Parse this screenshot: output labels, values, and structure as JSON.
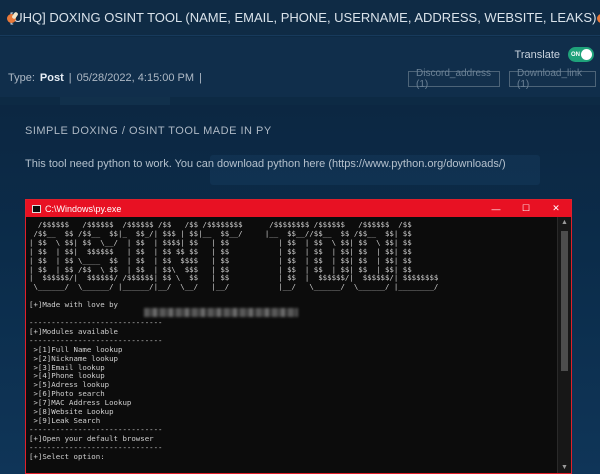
{
  "post": {
    "title": "[UHQ] DOXING OSINT TOOL (NAME, EMAIL, PHONE, USERNAME, ADDRESS, WEBSITE, LEAKS)",
    "title_icon_left": "meat-icon",
    "title_icon_right": "meat-icon",
    "translate_label": "Translate",
    "translate_toggle": "ON",
    "type_label": "Type:",
    "type_value": "Post",
    "separator": "|",
    "date": "05/28/2022, 4:15:00 PM",
    "discord_link": "Discord_address (1)",
    "download_link": "Download_link (1)"
  },
  "body": {
    "heading": "SIMPLE  DOXING  /  OSINT TOOL  MADE IN  PY",
    "intro": "This tool need python to work. You can download python here (https://www.python.org/downloads/)"
  },
  "window": {
    "title": "C:\\Windows\\py.exe",
    "minimize": "—",
    "maximize": "☐",
    "close": "✕",
    "console_lines": [
      "  /$$$$$$   /$$$$$$  /$$$$$$ /$$   /$$ /$$$$$$$$      /$$$$$$$$ /$$$$$$   /$$$$$$  /$$",
      " /$$__  $$ /$$__  $$|_  $$_/| $$$ | $$|__  $$__/     |__  $$__//$$__  $$ /$$__  $$| $$",
      "| $$  \\ $$| $$  \\__/  | $$  | $$$$| $$   | $$           | $$  | $$  \\ $$| $$  \\ $$| $$",
      "| $$  | $$|  $$$$$$   | $$  | $$ $$ $$   | $$           | $$  | $$  | $$| $$  | $$| $$",
      "| $$  | $$ \\____  $$  | $$  | $$  $$$$   | $$           | $$  | $$  | $$| $$  | $$| $$",
      "| $$  | $$ /$$  \\ $$  | $$  | $$\\  $$$   | $$           | $$  | $$  | $$| $$  | $$| $$",
      "|  $$$$$$/|  $$$$$$/ /$$$$$$| $$ \\  $$   | $$           | $$  |  $$$$$$/|  $$$$$$/| $$$$$$$$",
      " \\______/  \\______/ |______/|__/  \\__/   |__/           |__/   \\______/  \\______/ |________/",
      "",
      "[+]Made with love by",
      "",
      "------------------------------",
      "[+]Modules available",
      "------------------------------",
      " >[1]Full Name lookup",
      " >[2]Nickname lookup",
      " >[3]Email lookup",
      " >[4]Phone lookup",
      " >[5]Adress lookup",
      " >[6]Photo search",
      " >[7]MAC Address Lookup",
      " >[8]Website Lookup",
      " >[9]Leak Search",
      "------------------------------",
      "[+]Open your default browser",
      "------------------------------",
      "[+]Select option:"
    ]
  },
  "colors": {
    "page_bg": "#0d2a44",
    "toggle_on": "#1fa27a",
    "window_bar": "#e81123",
    "console_bg": "#0c0c0c"
  }
}
